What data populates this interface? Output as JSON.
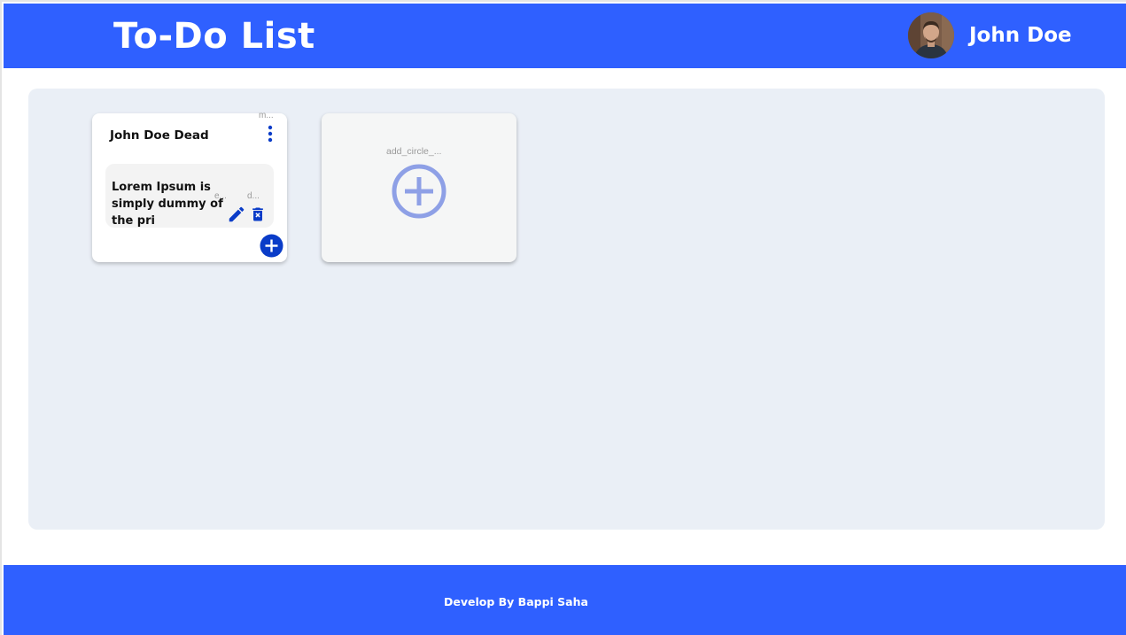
{
  "header": {
    "title": "To-Do List",
    "user_name": "John Doe"
  },
  "list_card": {
    "title": "John Doe Dead",
    "menu_icon_label": "m...",
    "tasks": [
      {
        "text": "Lorem Ipsum is simply dummy of the pri",
        "edit_icon_label": "e...",
        "delete_icon_label": "d..."
      }
    ]
  },
  "add_list_card": {
    "icon_label": "add_circle_..."
  },
  "footer": {
    "credit": "Develop By Bappi Saha"
  },
  "icons": {
    "menu": "more-vert-icon",
    "edit": "pencil-icon",
    "delete": "trash-icon",
    "add_task": "add-circle-icon",
    "add_list": "add-circle-outline-icon"
  },
  "colors": {
    "brand": "#2f60ff",
    "icon_primary": "#0a3cc8",
    "board_background": "#eaeff6",
    "add_icon": "#8ea0e6"
  }
}
